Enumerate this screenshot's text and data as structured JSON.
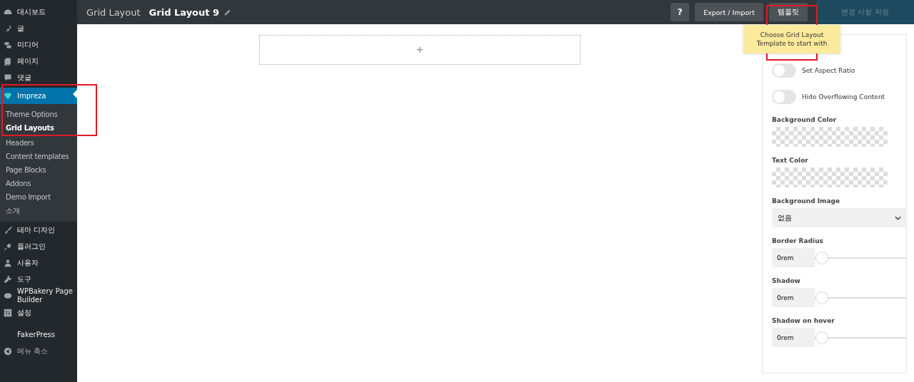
{
  "sidebar": {
    "items": [
      {
        "label": "대시보드",
        "kind": "main",
        "selected": false
      },
      {
        "label": "글",
        "kind": "main",
        "selected": false
      },
      {
        "label": "미디어",
        "kind": "main",
        "selected": false
      },
      {
        "label": "페이지",
        "kind": "main",
        "selected": false
      },
      {
        "label": "댓글",
        "kind": "main",
        "selected": false
      },
      {
        "label": "Impreza",
        "kind": "main",
        "selected": true,
        "highlighted": true,
        "children": [
          {
            "label": "Theme Options",
            "selected": false,
            "highlighted": true
          },
          {
            "label": "Grid Layouts",
            "selected": true,
            "highlighted": true
          },
          {
            "label": "Headers",
            "selected": false
          },
          {
            "label": "Content templates",
            "selected": false
          },
          {
            "label": "Page Blocks",
            "selected": false
          },
          {
            "label": "Addons",
            "selected": false
          },
          {
            "label": "Demo Import",
            "selected": false
          },
          {
            "label": "소개",
            "selected": false
          }
        ]
      },
      {
        "label": "테마 디자인",
        "kind": "main",
        "selected": false
      },
      {
        "label": "플러그인",
        "kind": "main",
        "selected": false
      },
      {
        "label": "사용자",
        "kind": "main",
        "selected": false
      },
      {
        "label": "도구",
        "kind": "main",
        "selected": false
      },
      {
        "label": "WPBakery Page Builder",
        "kind": "main",
        "selected": false
      },
      {
        "label": "설정",
        "kind": "main",
        "selected": false
      },
      {
        "label": "FakerPress",
        "kind": "plain",
        "selected": false
      },
      {
        "label": "메뉴 축소",
        "kind": "collapse",
        "selected": false
      }
    ]
  },
  "toolbar": {
    "breadcrumb": "Grid Layout",
    "title": "Grid Layout 9",
    "buttons": [
      {
        "label": "?",
        "kind": "help",
        "disabled": false,
        "highlighted": false
      },
      {
        "label": "Export / Import",
        "kind": "normal",
        "disabled": false,
        "highlighted": false
      },
      {
        "label": "템플릿",
        "kind": "normal",
        "disabled": false,
        "highlighted": true
      },
      {
        "label": "변경 사항 저장",
        "kind": "primary",
        "disabled": true,
        "highlighted": false
      }
    ]
  },
  "tooltip": {
    "text": "Choose Grid Layout Template to start with"
  },
  "canvas": {
    "add_label": "+"
  },
  "panel": {
    "fields": [
      {
        "kind": "toggle",
        "label": "Set Aspect Ratio",
        "on": false
      },
      {
        "kind": "toggle",
        "label": "Hide Overflowing Content",
        "on": false
      },
      {
        "kind": "color",
        "label": "Background Color"
      },
      {
        "kind": "color",
        "label": "Text Color"
      },
      {
        "kind": "select",
        "label": "Background Image",
        "value": "없음"
      },
      {
        "kind": "slider",
        "label": "Border Radius",
        "value": "0rem",
        "level": 0
      },
      {
        "kind": "slider",
        "label": "Shadow",
        "value": "0rem",
        "level": 0
      },
      {
        "kind": "slider",
        "label": "Shadow on hover",
        "value": "0rem",
        "level": 0
      }
    ]
  }
}
